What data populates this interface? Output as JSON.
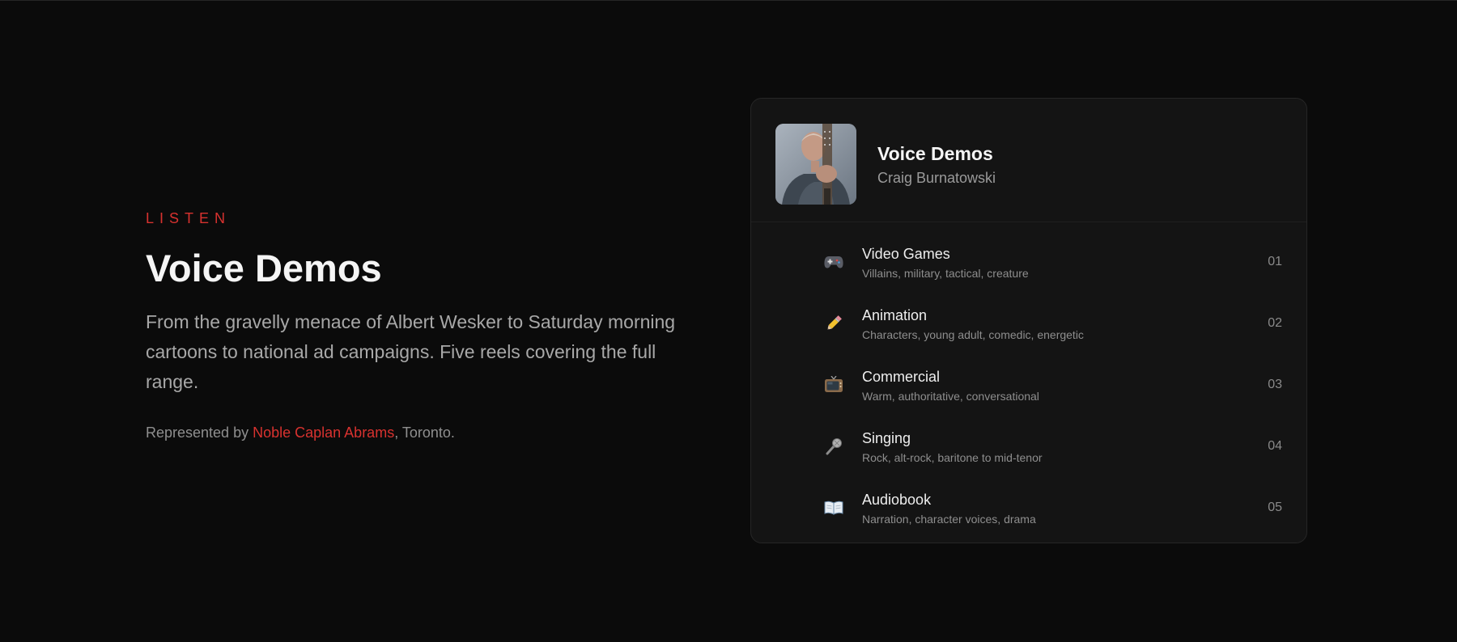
{
  "intro": {
    "eyebrow": "LISTEN",
    "title": "Voice Demos",
    "description": "From the gravelly menace of Albert Wesker to Saturday morning cartoons to national ad campaigns. Five reels covering the full range.",
    "rep_prefix": "Represented by ",
    "rep_agency": "Noble Caplan Abrams",
    "rep_suffix": ", Toronto."
  },
  "card": {
    "title": "Voice Demos",
    "artist": "Craig Burnatowski",
    "avatar_icon": "portrait-photo"
  },
  "tracks": [
    {
      "icon": "gamepad-icon",
      "name": "Video Games",
      "desc": "Villains, military, tactical, creature",
      "num": "01"
    },
    {
      "icon": "pencil-icon",
      "name": "Animation",
      "desc": "Characters, young adult, comedic, energetic",
      "num": "02"
    },
    {
      "icon": "tv-icon",
      "name": "Commercial",
      "desc": "Warm, authoritative, conversational",
      "num": "03"
    },
    {
      "icon": "microphone-icon",
      "name": "Singing",
      "desc": "Rock, alt-rock, baritone to mid-tenor",
      "num": "04"
    },
    {
      "icon": "book-icon",
      "name": "Audiobook",
      "desc": "Narration, character voices, drama",
      "num": "05"
    }
  ],
  "colors": {
    "accent": "#d8322f",
    "background": "#0b0b0b",
    "card": "#141414"
  }
}
